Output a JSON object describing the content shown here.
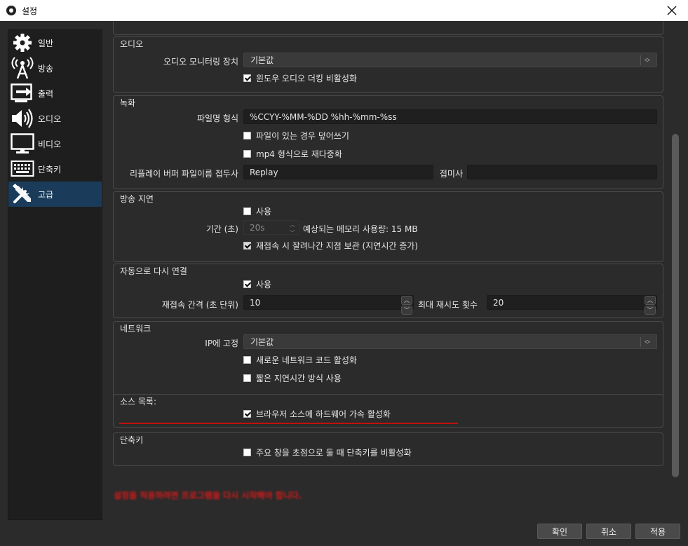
{
  "window": {
    "title": "설정"
  },
  "sidebar": {
    "items": [
      {
        "label": "일반",
        "icon": "gear-icon"
      },
      {
        "label": "방송",
        "icon": "broadcast-icon"
      },
      {
        "label": "출력",
        "icon": "output-icon"
      },
      {
        "label": "오디오",
        "icon": "speaker-icon"
      },
      {
        "label": "비디오",
        "icon": "monitor-icon"
      },
      {
        "label": "단축키",
        "icon": "keyboard-icon"
      },
      {
        "label": "고급",
        "icon": "tools-icon"
      }
    ],
    "active": "고급"
  },
  "audio": {
    "title": "오디오",
    "monitor_label": "오디오 모니터링 장치",
    "monitor_value": "기본값",
    "ducking_label": "윈도우 오디오 더킹 비활성화",
    "ducking_checked": true
  },
  "recording": {
    "title": "녹화",
    "filename_label": "파일명 형식",
    "filename_value": "%CCYY-%MM-%DD %hh-%mm-%ss",
    "overwrite_label": "파일이 있는 경우 덮어쓰기",
    "overwrite_checked": false,
    "remux_label": "mp4 형식으로 재다중화",
    "remux_checked": false,
    "replay_prefix_label": "리플레이 버퍼 파일이름 접두사",
    "replay_prefix_value": "Replay",
    "suffix_label": "접미사",
    "suffix_value": ""
  },
  "stream_delay": {
    "title": "방송 지연",
    "enable_label": "사용",
    "enable_checked": false,
    "duration_label": "기간 (초)",
    "duration_value": "20s",
    "memory_text": "예상되는 메모리 사용량: 15 MB",
    "preserve_label": "재접속 시 잘려나간 지점 보관 (지연시간 증가)",
    "preserve_checked": true
  },
  "reconnect": {
    "title": "자동으로 다시 연결",
    "enable_label": "사용",
    "enable_checked": true,
    "interval_label": "재접속 간격 (초 단위)",
    "interval_value": "10",
    "retries_label": "최대 재시도 횟수",
    "retries_value": "20"
  },
  "network": {
    "title": "네트워크",
    "bind_ip_label": "IP에 고정",
    "bind_ip_value": "기본값",
    "new_code_label": "새로운 네트워크 코드 활성화",
    "new_code_checked": false,
    "low_latency_label": "짧은 지연시간 방식 사용",
    "low_latency_checked": false
  },
  "sources": {
    "title": "소스 목록:",
    "hw_accel_label": "브라우저 소스에 하드웨어 가속 활성화",
    "hw_accel_checked": true
  },
  "hotkeys": {
    "title": "단축키",
    "disable_label": "주요 창을 초점으로 둘 때 단축키를 비활성화",
    "disable_checked": false
  },
  "warning_text": "설정을 적용하려면 프로그램을 다시 시작해야 합니다.",
  "buttons": {
    "ok": "확인",
    "cancel": "취소",
    "apply": "적용"
  },
  "colors": {
    "accent": "#1a3c5a",
    "warning": "#d11a1a",
    "highlight_line": "#c01010"
  }
}
